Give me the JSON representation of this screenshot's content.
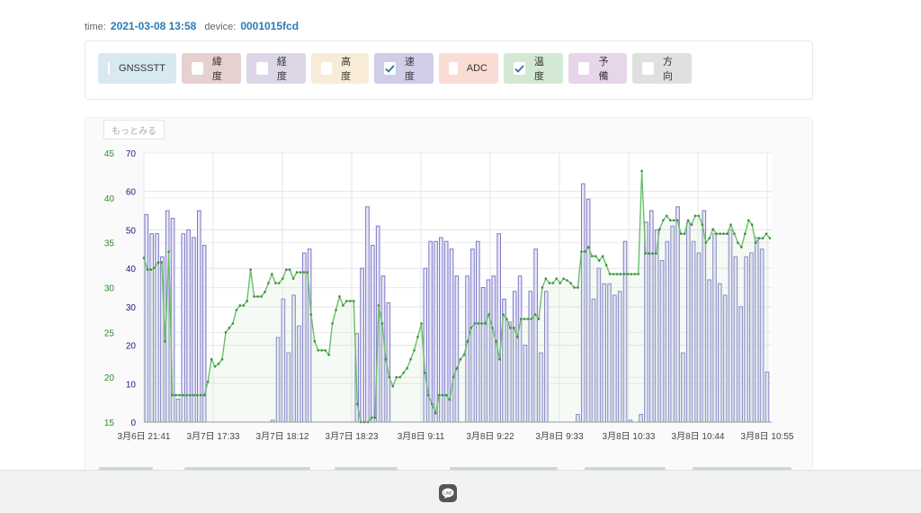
{
  "header": {
    "time_label": "time:",
    "time_value": "2021-03-08 13:58",
    "device_label": "device:",
    "device_value": "0001015fcd"
  },
  "filters": [
    {
      "label": "GNSSSTT",
      "checked": false,
      "color": "#d9e9f2"
    },
    {
      "label": "緯度",
      "checked": false,
      "color": "#e6d0d0"
    },
    {
      "label": "経度",
      "checked": false,
      "color": "#dcd6e6"
    },
    {
      "label": "高度",
      "checked": false,
      "color": "#f8ecd8"
    },
    {
      "label": "速度",
      "checked": true,
      "color": "#cfcde8"
    },
    {
      "label": "ADC",
      "checked": false,
      "color": "#fbdcd4"
    },
    {
      "label": "温度",
      "checked": true,
      "color": "#d3e9d3"
    },
    {
      "label": "予備",
      "checked": false,
      "color": "#e7d5ea"
    },
    {
      "label": "方向",
      "checked": false,
      "color": "#e0e0e0"
    }
  ],
  "more_button": "もっとみる",
  "chart_data": {
    "type": "bar",
    "x_labels": [
      "3月6日 21:41",
      "3月7日 17:33",
      "3月7日 18:12",
      "3月7日 18:23",
      "3月8日 9:11",
      "3月8日 9:22",
      "3月8日 9:33",
      "3月8日 10:33",
      "3月8日 10:44",
      "3月8日 10:55"
    ],
    "y_left": {
      "ticks": [
        15,
        20,
        25,
        30,
        35,
        40,
        45
      ],
      "range": [
        15,
        45
      ],
      "color": "#2e8b2e"
    },
    "y_right": {
      "ticks": [
        0,
        10,
        20,
        30,
        40,
        50,
        60,
        70
      ],
      "range": [
        0,
        70
      ],
      "color": "#1a1a80"
    },
    "series": [
      {
        "kind": "bar",
        "axis": "right",
        "color": "#7b78c8",
        "values": [
          54,
          49,
          49,
          43,
          55,
          53,
          6,
          49,
          50,
          48,
          55,
          46,
          0,
          0,
          0,
          0,
          0,
          0,
          0,
          0,
          0,
          0,
          0,
          0,
          0.5,
          22,
          32,
          18,
          33,
          25,
          44,
          45,
          0,
          0,
          0,
          0,
          0,
          0,
          0,
          0,
          23,
          40,
          56,
          46,
          51,
          38,
          31,
          0,
          0,
          0,
          0,
          0,
          0,
          40,
          47,
          47,
          48,
          47,
          45,
          38,
          0,
          38,
          45,
          47,
          35,
          37,
          38,
          49,
          32,
          26,
          34,
          38,
          20,
          34,
          45,
          18,
          34,
          0,
          0,
          0,
          0,
          0,
          2,
          62,
          58,
          32,
          40,
          36,
          36,
          33,
          34,
          47,
          0.5,
          0,
          2,
          52,
          55,
          50,
          42,
          47,
          51,
          56,
          18,
          52,
          47,
          44,
          55,
          37,
          49,
          36,
          33,
          50,
          43,
          30,
          43,
          44,
          48,
          45,
          13
        ]
      },
      {
        "kind": "line",
        "axis": "left",
        "color": "#6abf6a",
        "values": [
          33.3,
          32,
          32,
          32.2,
          32.8,
          32.8,
          24,
          34,
          18,
          18,
          18,
          18,
          18,
          18,
          18,
          18,
          18,
          18,
          19.5,
          22,
          21.2,
          21.5,
          22,
          25,
          25.5,
          26,
          27.5,
          28,
          28,
          28.5,
          32,
          29,
          29,
          29,
          29.5,
          30.5,
          31.5,
          30.5,
          30.5,
          31,
          32,
          32,
          31,
          31.7,
          31.7,
          31.7,
          31.7,
          27,
          24,
          23,
          23,
          23,
          22.5,
          26,
          27.5,
          29,
          28,
          28.5,
          28.5,
          28.5,
          17,
          15,
          15,
          15,
          15.5,
          15.5,
          28,
          26,
          22,
          20,
          19,
          20,
          20,
          20.5,
          21,
          22,
          23,
          24.5,
          26,
          20.5,
          18,
          17,
          16,
          18,
          18,
          18,
          17.5,
          20,
          21,
          22,
          22.5,
          24,
          25.5,
          26,
          26,
          26,
          26,
          27,
          25.5,
          24,
          22,
          27,
          26.5,
          25.5,
          25.5,
          24.5,
          26.5,
          26.5,
          26.5,
          26.5,
          27,
          26.5,
          30,
          31,
          30.5,
          30.5,
          31,
          30.5,
          31,
          30.8,
          30.5,
          30,
          30,
          34,
          34,
          34.5,
          33.5,
          33.5,
          33,
          33.5,
          32.5,
          31.5,
          31.5,
          31.5,
          31.5,
          31.5,
          31.5,
          31.5,
          31.5,
          31.5,
          43,
          33.8,
          33.8,
          33.8,
          33.8,
          36.5,
          37.5,
          38,
          37.5,
          37.5,
          37.5,
          36,
          36,
          37.5,
          37,
          38,
          38,
          37,
          35,
          35.5,
          36.5,
          36,
          36,
          36,
          36,
          37,
          36,
          35,
          34.5,
          36,
          37.5,
          37,
          35,
          35.5,
          35.5,
          36,
          35.5
        ]
      }
    ]
  }
}
